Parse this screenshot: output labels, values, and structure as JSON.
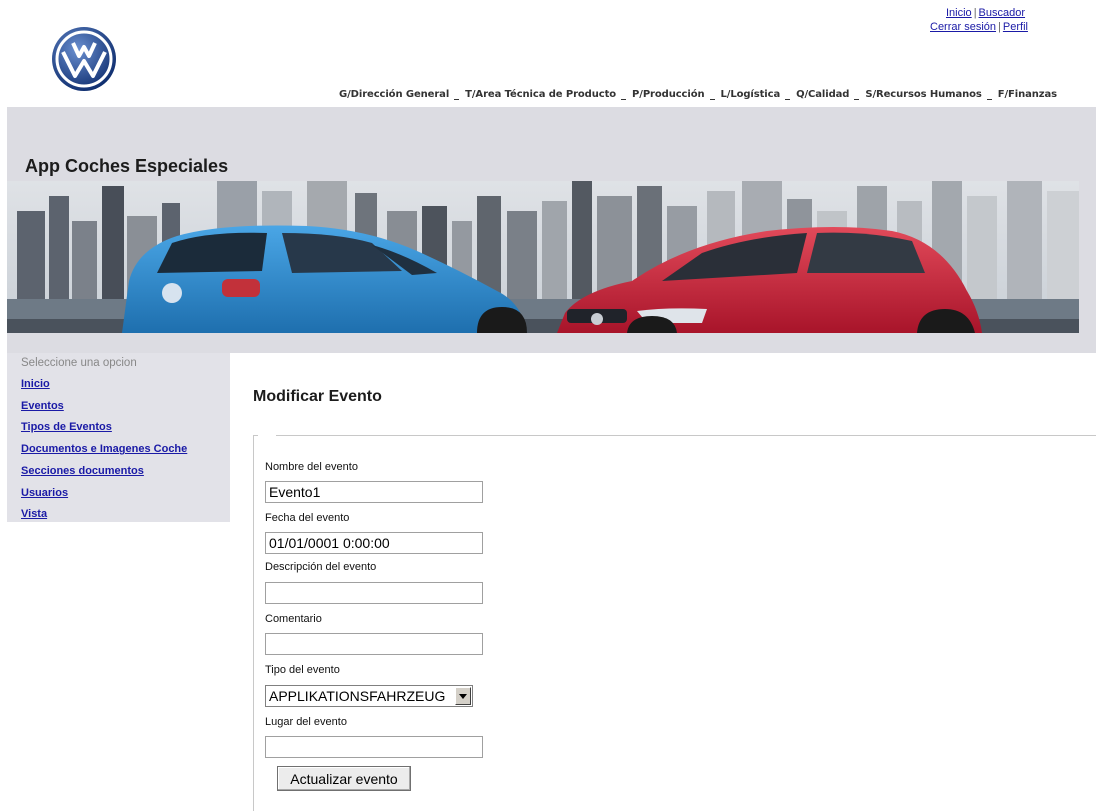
{
  "util_links": {
    "inicio": "Inicio",
    "sep": "|",
    "buscador": "Buscador",
    "cerrar_sesion": "Cerrar sesión",
    "perfil": "Perfil"
  },
  "logo_text": "VW",
  "divisions": [
    "G/Dirección General",
    "T/Area Técnica de Producto",
    "P/Producción",
    "L/Logística",
    "Q/Calidad",
    "S/Recursos Humanos",
    "F/Finanzas"
  ],
  "app_title": "App Coches Especiales",
  "sidebar": {
    "hint": "Seleccione una opcion",
    "items": [
      "Inicio",
      "Eventos",
      "Tipos de Eventos",
      "Documentos e Imagenes Coche",
      "Secciones documentos",
      "Usuarios",
      "Vista"
    ]
  },
  "page_title": "Modificar Evento",
  "form": {
    "nombre_label": "Nombre del evento",
    "nombre_value": "Evento1",
    "fecha_label": "Fecha del evento",
    "fecha_value": "01/01/0001 0:00:00",
    "descripcion_label": "Descripción del evento",
    "descripcion_value": "",
    "comentario_label": "Comentario",
    "comentario_value": "",
    "tipo_label": "Tipo del evento",
    "tipo_selected": "APPLIKATIONSFAHRZEUG",
    "lugar_label": "Lugar del evento",
    "lugar_value": "",
    "submit_label": "Actualizar evento"
  },
  "colors": {
    "link": "#1a1aa6",
    "banner_bg": "#dcdce2",
    "sidebar_bg": "#e2e2e8",
    "blue_car": "#2f86c8",
    "red_car": "#c81e32"
  }
}
